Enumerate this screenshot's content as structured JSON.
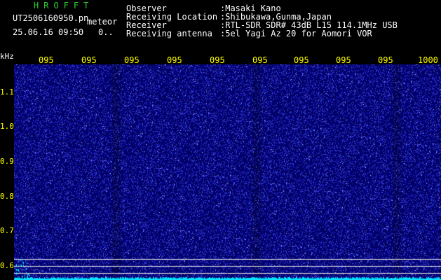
{
  "header": {
    "app_title": "HROFFT",
    "file_name": "UT2506160950.pn",
    "meteor_label": "meteor",
    "date_time": "25.06.16 09:50",
    "count": "0.."
  },
  "station_info": [
    {
      "key": "Observer",
      "value": ":Masaki Kano"
    },
    {
      "key": "Receiving Location",
      "value": ":Shibukawa,Gunma,Japan"
    },
    {
      "key": "Receiver",
      "value": ":RTL-SDR SDR# 43dB L15 114.1MHz USB"
    },
    {
      "key": "Receiving antenna",
      "value": ":5el Yagi Az 20 for Aomori VOR"
    }
  ],
  "plot": {
    "unit_label": "kHz",
    "time_ticks": [
      "095",
      "095",
      "095",
      "095",
      "095",
      "095",
      "095",
      "095",
      "095",
      "1000"
    ],
    "freq_ticks": [
      "1.1",
      "1.0",
      "0.9",
      "0.8",
      "0.7",
      "0.6"
    ],
    "colors": {
      "background": "#0a0a6e",
      "noise": "#3c46ff",
      "baseline": "#00e5ff",
      "marker_line": "#e6e6e6",
      "tick_color": "#ffff00"
    }
  }
}
